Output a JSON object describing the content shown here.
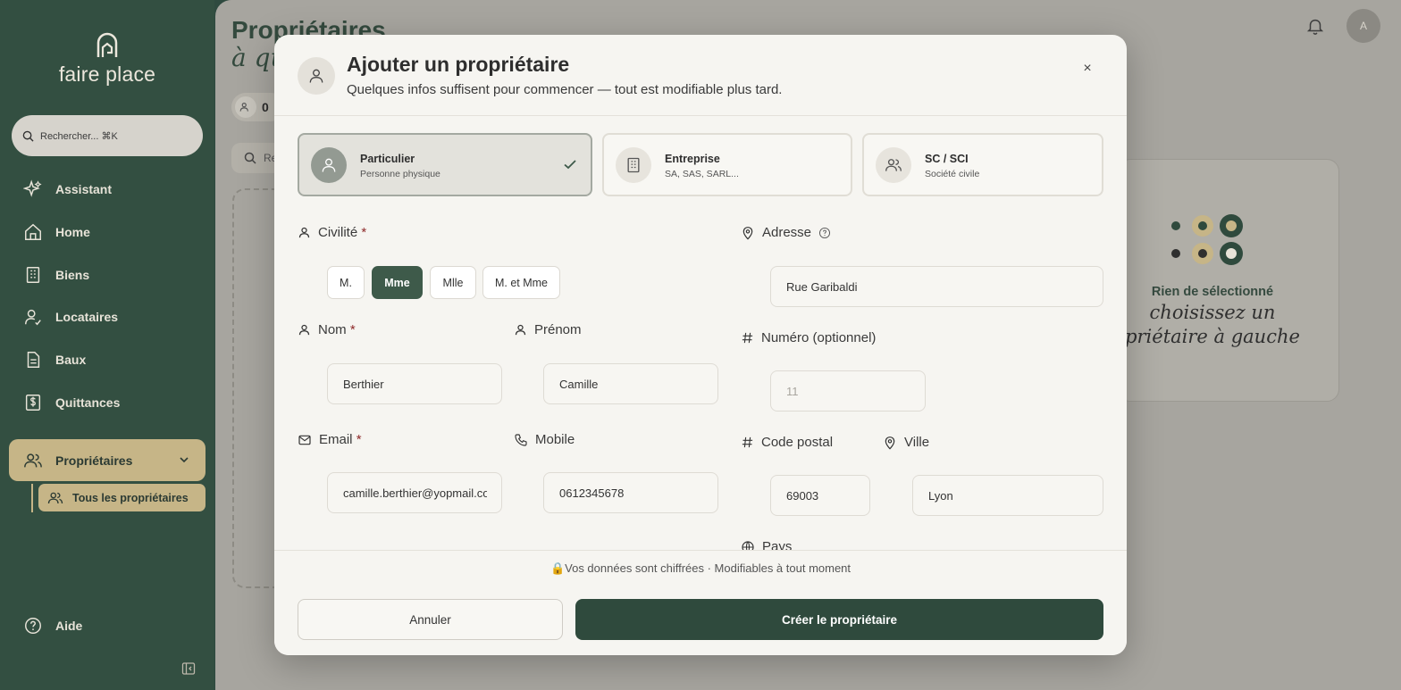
{
  "sidebar": {
    "logo_text": "faire place",
    "search_placeholder": "Rechercher... ⌘K",
    "items": [
      {
        "label": "Assistant",
        "icon": "sparkle-icon"
      },
      {
        "label": "Home",
        "icon": "home-icon"
      },
      {
        "label": "Biens",
        "icon": "building-icon"
      },
      {
        "label": "Locataires",
        "icon": "user-check-icon"
      },
      {
        "label": "Baux",
        "icon": "document-icon"
      },
      {
        "label": "Quittances",
        "icon": "receipt-icon"
      }
    ],
    "active_group": "Propriétaires",
    "sub_item": "Tous les propriétaires",
    "help": "Aide"
  },
  "background": {
    "title": "Propriétaires",
    "subtitle": "à qu",
    "count": "0",
    "search_placeholder": "Re",
    "avatar_initial": "A",
    "empty_title": "Rien de sélectionné",
    "empty_script_1": "choisissez un",
    "empty_script_2": "priétaire à gauche"
  },
  "modal": {
    "title": "Ajouter un propriétaire",
    "subtitle": "Quelques infos suffisent pour commencer — tout est modifiable plus tard.",
    "close": "×",
    "types": [
      {
        "title": "Particulier",
        "subtitle": "Personne physique",
        "selected": true
      },
      {
        "title": "Entreprise",
        "subtitle": "SA, SAS, SARL...",
        "selected": false
      },
      {
        "title": "SC / SCI",
        "subtitle": "Société civile",
        "selected": false
      }
    ],
    "civilite_label": "Civilité",
    "civilite_options": [
      "M.",
      "Mme",
      "Mlle",
      "M. et Mme"
    ],
    "civilite_selected": "Mme",
    "nom_label": "Nom",
    "nom_value": "Berthier",
    "prenom_label": "Prénom",
    "prenom_value": "Camille",
    "email_label": "Email",
    "email_value": "camille.berthier@yopmail.com",
    "mobile_label": "Mobile",
    "mobile_value": "0612345678",
    "adresse_label": "Adresse",
    "adresse_value": "Rue Garibaldi",
    "numero_label": "Numéro (optionnel)",
    "numero_placeholder": "11",
    "cp_label": "Code postal",
    "cp_value": "69003",
    "ville_label": "Ville",
    "ville_value": "Lyon",
    "pays_label": "Pays",
    "required_mark": "*",
    "secure_text": "🔒Vos données sont chiffrées · Modifiables à tout moment",
    "cancel": "Annuler",
    "create": "Créer le propriétaire"
  }
}
